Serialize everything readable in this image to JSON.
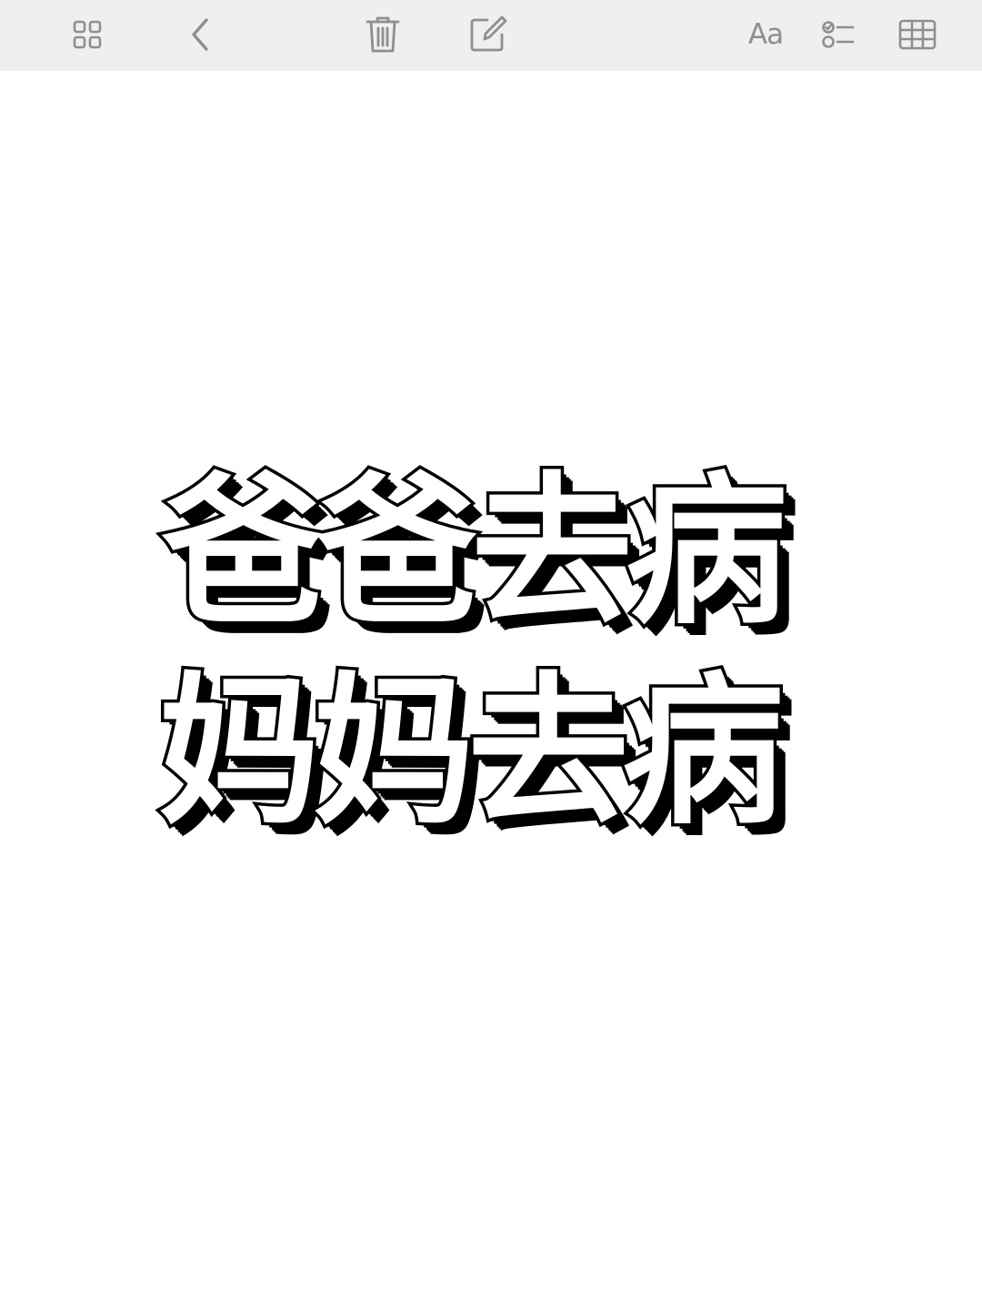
{
  "toolbar": {
    "font_button_label": "Aa",
    "icons": {
      "gallery": "gallery-grid-icon",
      "back": "chevron-left-icon",
      "delete": "trash-icon",
      "compose": "compose-icon",
      "checklist": "checklist-icon",
      "table": "table-icon"
    },
    "icon_color": "#8e8e93",
    "background_color": "#efefef"
  },
  "note": {
    "lines": [
      "爸爸去病",
      "妈妈去病"
    ],
    "text_fill_color": "#ffffff",
    "text_outline_color": "#000000"
  }
}
